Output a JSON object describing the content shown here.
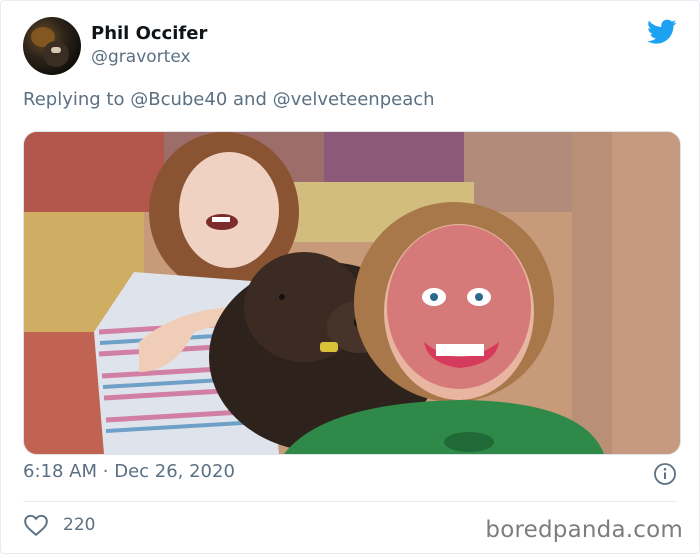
{
  "author": {
    "name": "Phil Occifer",
    "handle": "@gravortex"
  },
  "reply": {
    "prefix": "Replying to",
    "mention1": "@Bcube40",
    "connector": "and",
    "mention2": "@velveteenpeach"
  },
  "tweet": {
    "time": "6:18 AM",
    "separator": "·",
    "date": "Dec 26, 2020",
    "likes": "220"
  },
  "watermark": "boredpanda.com",
  "colors": {
    "twitter_blue": "#1da1f2",
    "secondary_text": "#5b7083",
    "divider": "#e6ecf0"
  },
  "icons": {
    "brand": "twitter-bird-icon",
    "info": "info-icon",
    "like": "heart-icon"
  }
}
